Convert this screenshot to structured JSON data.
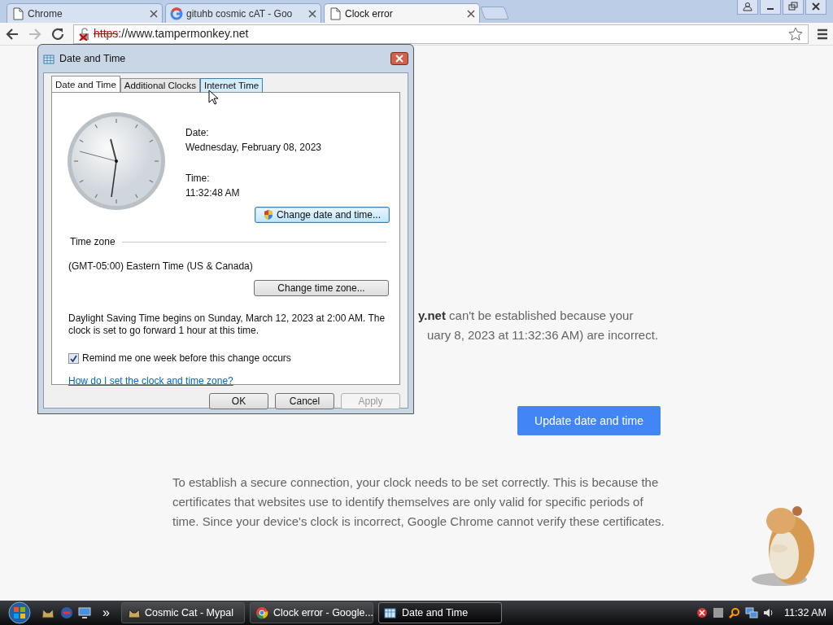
{
  "browser": {
    "tabs": [
      {
        "title": "Chrome",
        "kind": "page",
        "selected": false
      },
      {
        "title": "gituhb cosmic cAT - Goo",
        "kind": "google",
        "selected": false
      },
      {
        "title": "Clock error",
        "kind": "page",
        "selected": true
      }
    ],
    "address": {
      "scheme": "https",
      "rest": "://www.tampermonkey.net"
    }
  },
  "page": {
    "message_lines": [
      "**y.net** can't be established because your",
      "uary 8, 2023 at 11:32:36 AM) are incorrect."
    ],
    "update_button": "Update date and time",
    "explanation": "To establish a secure connection, your clock needs to be set correctly. This is because the certificates that websites use to identify themselves are only valid for specific periods of time. Since your device's clock is incorrect, Google Chrome cannot verify these certificates."
  },
  "dialog": {
    "title": "Date and Time",
    "tabs": [
      {
        "label": "Date and Time",
        "selected": true,
        "hovered": false
      },
      {
        "label": "Additional Clocks",
        "selected": false,
        "hovered": false
      },
      {
        "label": "Internet Time",
        "selected": false,
        "hovered": true
      }
    ],
    "date_label": "Date:",
    "date_value": "Wednesday, February 08, 2023",
    "time_label": "Time:",
    "time_value": "11:32:48 AM",
    "change_datetime_button": "Change date and time...",
    "timezone_heading": "Time zone",
    "timezone_value": "(GMT-05:00) Eastern Time (US & Canada)",
    "change_timezone_button": "Change time zone...",
    "dst_note": "Daylight Saving Time begins on Sunday, March 12, 2023 at 2:00 AM. The clock is set to go forward 1 hour at this time.",
    "reminder": {
      "label": "Remind me one week before this change occurs",
      "checked": true
    },
    "help_link": "How do I set the clock and time zone?",
    "buttons": [
      {
        "label": "OK",
        "disabled": false
      },
      {
        "label": "Cancel",
        "disabled": false
      },
      {
        "label": "Apply",
        "disabled": true
      }
    ]
  },
  "taskbar": {
    "tasks": [
      {
        "label": "Cosmic Cat - Mypal",
        "kind": "cat",
        "selected": false
      },
      {
        "label": "Clock error - Google...",
        "kind": "chrome",
        "selected": false
      },
      {
        "label": "Date and Time",
        "kind": "calendar",
        "selected": true
      }
    ],
    "more": "»",
    "clock": "11:32 AM"
  }
}
